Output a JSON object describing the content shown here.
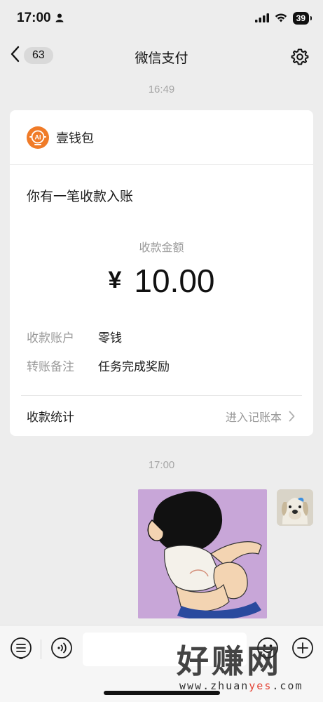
{
  "status_bar": {
    "time": "17:00",
    "battery": "39"
  },
  "nav": {
    "unread_count": "63",
    "title": "微信支付"
  },
  "messages": {
    "timestamp_1": "16:49",
    "timestamp_2": "17:00"
  },
  "payment_card": {
    "brand_name": "壹钱包",
    "brand_logo_text": "AI",
    "title": "你有一笔收款入账",
    "amount_label": "收款金额",
    "currency_symbol": "¥",
    "amount": "10.00",
    "details": [
      {
        "key": "收款账户",
        "value": "零钱"
      },
      {
        "key": "转账备注",
        "value": "任务完成奖励"
      }
    ],
    "footer_left": "收款统计",
    "footer_right": "进入记账本"
  },
  "watermark": {
    "title": "好赚网",
    "domain_start": "www.zhuan",
    "domain_accent": "yes",
    "domain_end": ".com"
  },
  "colors": {
    "background": "#ededed",
    "card": "#ffffff",
    "brand_orange": "#f07b28",
    "muted_text": "#999999",
    "sticker_bg": "#c8a6d8"
  },
  "icons": {
    "back": "chevron-left-icon",
    "settings": "gear-icon",
    "chevron": "chevron-right-icon",
    "menu": "list-icon",
    "voice": "voice-icon",
    "emoji": "emoji-icon",
    "plus": "plus-icon"
  }
}
